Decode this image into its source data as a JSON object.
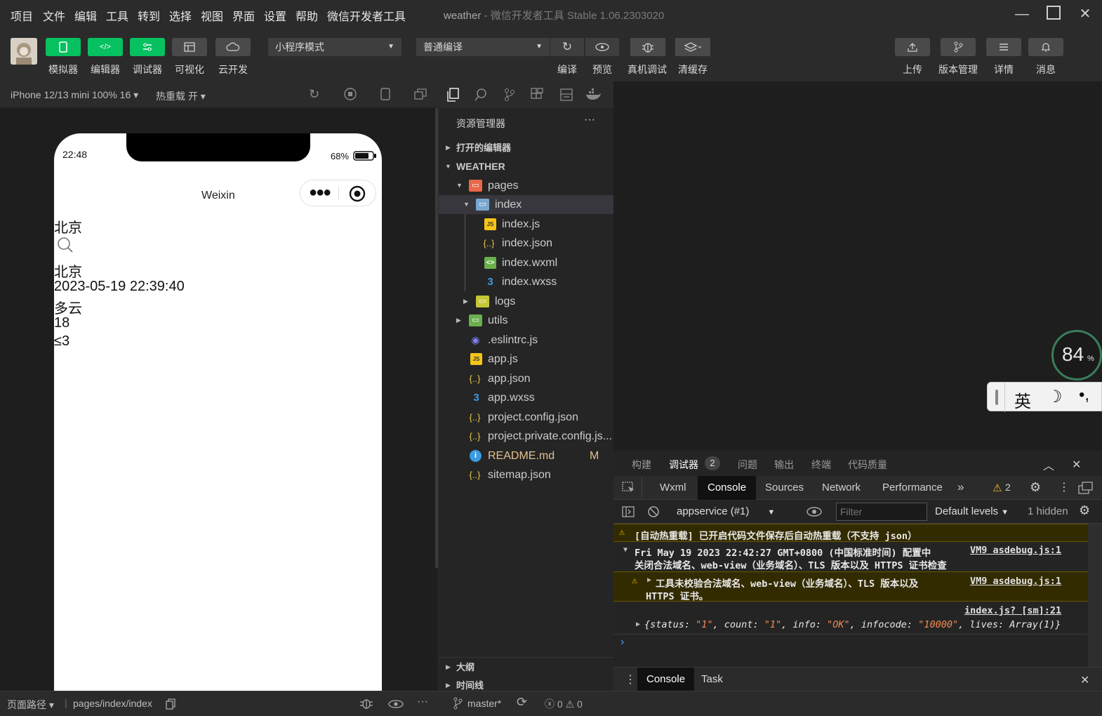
{
  "menubar": {
    "items": [
      "项目",
      "文件",
      "编辑",
      "工具",
      "转到",
      "选择",
      "视图",
      "界面",
      "设置",
      "帮助",
      "微信开发者工具"
    ],
    "title_app": "weather",
    "title_rest": " - 微信开发者工具 Stable 1.06.2303020"
  },
  "toolbar": {
    "left_buttons": [
      "模拟器",
      "编辑器",
      "调试器",
      "可视化",
      "云开发"
    ],
    "mode_select": "小程序模式",
    "compile_select": "普通编译",
    "mid_buttons": [
      "编译",
      "预览",
      "真机调试",
      "清缓存"
    ],
    "right_buttons": [
      "上传",
      "版本管理",
      "详情",
      "消息"
    ]
  },
  "simulator": {
    "device": "iPhone 12/13 mini 100% 16",
    "hot_reload": "热重载 开",
    "status_time": "22:48",
    "battery": "68%",
    "nav_title": "Weixin",
    "content": {
      "city_input": "北京",
      "city": "北京",
      "datetime": "2023-05-19 22:39:40",
      "weather": "多云",
      "temperature": "18",
      "wind": "≤3"
    }
  },
  "explorer": {
    "title": "资源管理器",
    "open_editors": "打开的编辑器",
    "project": "WEATHER",
    "files": [
      {
        "name": "pages",
        "type": "folder-open"
      },
      {
        "name": "index",
        "type": "folder-open"
      },
      {
        "name": "index.js",
        "type": "js"
      },
      {
        "name": "index.json",
        "type": "json"
      },
      {
        "name": "index.wxml",
        "type": "wxml"
      },
      {
        "name": "index.wxss",
        "type": "wxss"
      },
      {
        "name": "logs",
        "type": "folder"
      },
      {
        "name": "utils",
        "type": "folder"
      },
      {
        "name": ".eslintrc.js",
        "type": "eslint"
      },
      {
        "name": "app.js",
        "type": "js"
      },
      {
        "name": "app.json",
        "type": "json"
      },
      {
        "name": "app.wxss",
        "type": "wxss"
      },
      {
        "name": "project.config.json",
        "type": "json"
      },
      {
        "name": "project.private.config.js...",
        "type": "json"
      },
      {
        "name": "README.md",
        "type": "info"
      },
      {
        "name": "sitemap.json",
        "type": "json"
      }
    ],
    "readme_badge": "M",
    "outline": "大纲",
    "timeline": "时间线"
  },
  "widgets": {
    "perf": "84",
    "perf_unit": "%",
    "ime_lang": "英"
  },
  "devtools": {
    "top_tabs": [
      "构建",
      "调试器",
      "问题",
      "输出",
      "终端",
      "代码质量"
    ],
    "debugger_badge": "2",
    "tabs": [
      "Wxml",
      "Console",
      "Sources",
      "Network",
      "Performance"
    ],
    "warn_count": "2",
    "context": "appservice (#1)",
    "filter_placeholder": "Filter",
    "levels": "Default levels",
    "hidden": "1 hidden",
    "logs": {
      "l1": "[自动热重载] 已开启代码文件保存后自动热重载（不支持 json）",
      "l2a": "Fri May 19 2023 22:42:27 GMT+0800 (中国标准时间) 配置中",
      "l2b": "关闭合法域名、web-view（业务域名）、TLS 版本以及 HTTPS 证书检查",
      "l2src": "VM9 asdebug.js:1",
      "l3a": "工具未校验合法域名、web-view（业务域名）、TLS 版本以及",
      "l3b": "HTTPS 证书。",
      "l3src": "VM9 asdebug.js:1",
      "l4src": "index.js? [sm]:21",
      "l4_prefix": "{status: ",
      "l4_status": "\"1\"",
      "l4_count_key": ", count: ",
      "l4_count": "\"1\"",
      "l4_info_key": ", info: ",
      "l4_info": "\"OK\"",
      "l4_infocode_key": ", infocode: ",
      "l4_infocode": "\"10000\"",
      "l4_suffix": ", lives: Array(1)}"
    },
    "drawer_tabs": [
      "Console",
      "Task"
    ]
  },
  "statusbar": {
    "page_path_label": "页面路径",
    "page_path": "pages/index/index",
    "branch": "master*",
    "errors": "0",
    "warnings": "0"
  }
}
